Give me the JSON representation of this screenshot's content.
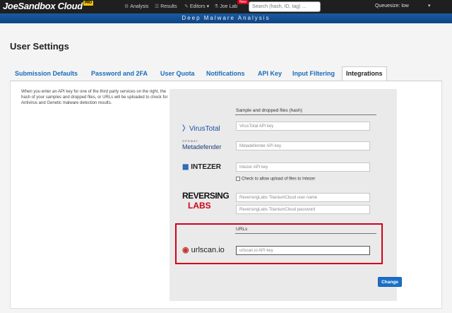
{
  "app": {
    "logo_prefix": "Joe",
    "logo_main": "Sandbox Cloud",
    "logo_badge": "PRO",
    "banner": "Deep Malware Analysis",
    "queuesize": "Queuesize: low"
  },
  "nav": {
    "items": [
      {
        "label": "Analysis",
        "icon": "gear-icon"
      },
      {
        "label": "Results",
        "icon": "list-icon"
      },
      {
        "label": "Editors",
        "icon": "pencil-icon"
      },
      {
        "label": "Joe Lab",
        "icon": "flask-icon"
      }
    ],
    "new_badge": "New",
    "search_placeholder": "Search (hash, ID, tag) ..."
  },
  "page": {
    "title": "User Settings"
  },
  "tabs": [
    {
      "label": "Submission Defaults",
      "active": false
    },
    {
      "label": "Password and 2FA",
      "active": false
    },
    {
      "label": "User Quota",
      "active": false
    },
    {
      "label": "Notifications",
      "active": false
    },
    {
      "label": "API Key",
      "active": false
    },
    {
      "label": "Input Filtering",
      "active": false
    },
    {
      "label": "Integrations",
      "active": true
    }
  ],
  "integrations": {
    "help_text": "When you enter an API key for one of the third party services on the right, the hash of your samples and dropped files, or URLs will be uploaded to check for Antivirus and Genetic malware detection results.",
    "section_files": "Sample and dropped files (hash)",
    "section_urls": "URLs",
    "virustotal": {
      "name": "VirusTotal",
      "placeholder": "VirusTotal API key"
    },
    "metadefender": {
      "name_top": "OPSWAT",
      "name": "Metadefender",
      "placeholder": "Metadefender API key"
    },
    "intezer": {
      "name": "INTEZER",
      "placeholder": "Intezer API key",
      "checkbox_label": "Check to allow upload of files to Intezer"
    },
    "reversinglabs": {
      "name_top": "REVERSING",
      "name_bottom": "LABS",
      "placeholder_user": "ReversingLabs TitaniumCloud user name",
      "placeholder_pass": "ReversingLabs TitaniumCloud password"
    },
    "urlscan": {
      "name": "urlscan.io",
      "placeholder": "urlscan.io API key"
    },
    "change_button": "Change"
  },
  "colors": {
    "nav_bg": "#1f1f1f",
    "banner_bg": "#0e4585",
    "tab_link": "#1a6bb8",
    "highlight_red": "#d0021b",
    "button_blue": "#1a70c8"
  }
}
